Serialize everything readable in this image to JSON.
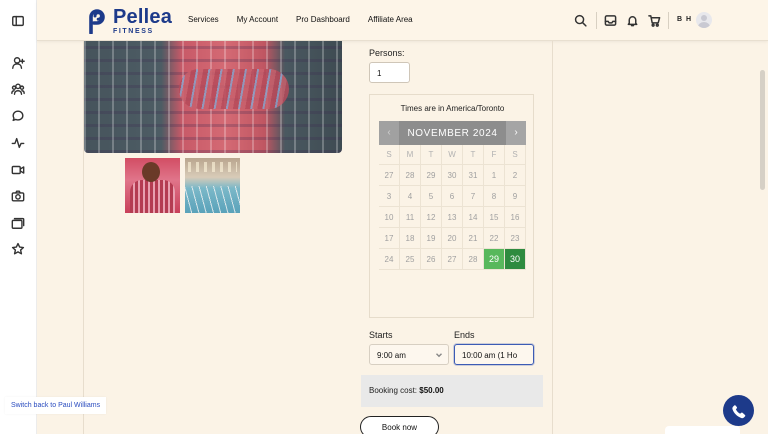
{
  "brand": {
    "name": "Pellea",
    "sub": "FITNESS",
    "color": "#1d3a8a"
  },
  "nav": {
    "items": [
      "Services",
      "My Account",
      "Pro Dashboard",
      "Affiliate Area"
    ]
  },
  "header": {
    "initials": "B H"
  },
  "rail_icons": [
    "sidebar-toggle-icon",
    "user-plus-icon",
    "users-icon",
    "chat-icon",
    "activity-icon",
    "video-icon",
    "camera-icon",
    "gallery-icon",
    "star-icon"
  ],
  "booking": {
    "persons_label": "Persons:",
    "persons_value": "1",
    "timezone_text": "Times are in America/Toronto",
    "calendar": {
      "month_label": "NOVEMBER 2024",
      "prev_label": "‹",
      "next_label": "›",
      "weekdays": [
        "S",
        "M",
        "T",
        "W",
        "T",
        "F",
        "S"
      ],
      "weeks": [
        [
          "27",
          "28",
          "29",
          "30",
          "31",
          "1",
          "2"
        ],
        [
          "3",
          "4",
          "5",
          "6",
          "7",
          "8",
          "9"
        ],
        [
          "10",
          "11",
          "12",
          "13",
          "14",
          "15",
          "16"
        ],
        [
          "17",
          "18",
          "19",
          "20",
          "21",
          "22",
          "23"
        ],
        [
          "24",
          "25",
          "26",
          "27",
          "28",
          "29",
          "30"
        ]
      ],
      "available_days": [
        "29"
      ],
      "selected_day": "30",
      "available_color": "#58b85c",
      "selected_color": "#2e8b3f"
    },
    "starts_label": "Starts",
    "ends_label": "Ends",
    "start_value": "9:00 am",
    "end_value": "10:00 am (1 Ho",
    "cost_label": "Booking cost:",
    "cost_value": "$50.00",
    "book_label": "Book now"
  },
  "switch_back": "Switch back to Paul Williams"
}
